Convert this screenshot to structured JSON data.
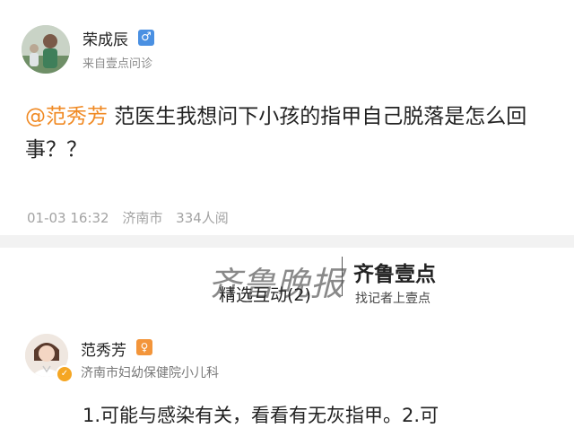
{
  "question_post": {
    "user_name": "荣成辰",
    "gender_icon": "male-icon",
    "source": "来自壹点问诊",
    "mention": "@范秀芳",
    "question_text": " 范医生我想问下小孩的指甲自己脱落是怎么回事？？",
    "date": "01-03 16:32",
    "location": "济南市",
    "views": "334人阅"
  },
  "section": {
    "title": "精选互动(2)"
  },
  "watermark": {
    "logo_text": "齐鲁晚报",
    "brand": "齐鲁壹点",
    "slogan": "找记者上壹点"
  },
  "answer": {
    "doctor_name": "范秀芳",
    "hospital": "济南市妇幼保健院小儿科",
    "text": "1.可能与感染有关，看看有无灰指甲。2.可"
  },
  "colors": {
    "mention": "#f08a24",
    "male_badge": "#4a90e2",
    "doctor_badge": "#f3953a"
  }
}
